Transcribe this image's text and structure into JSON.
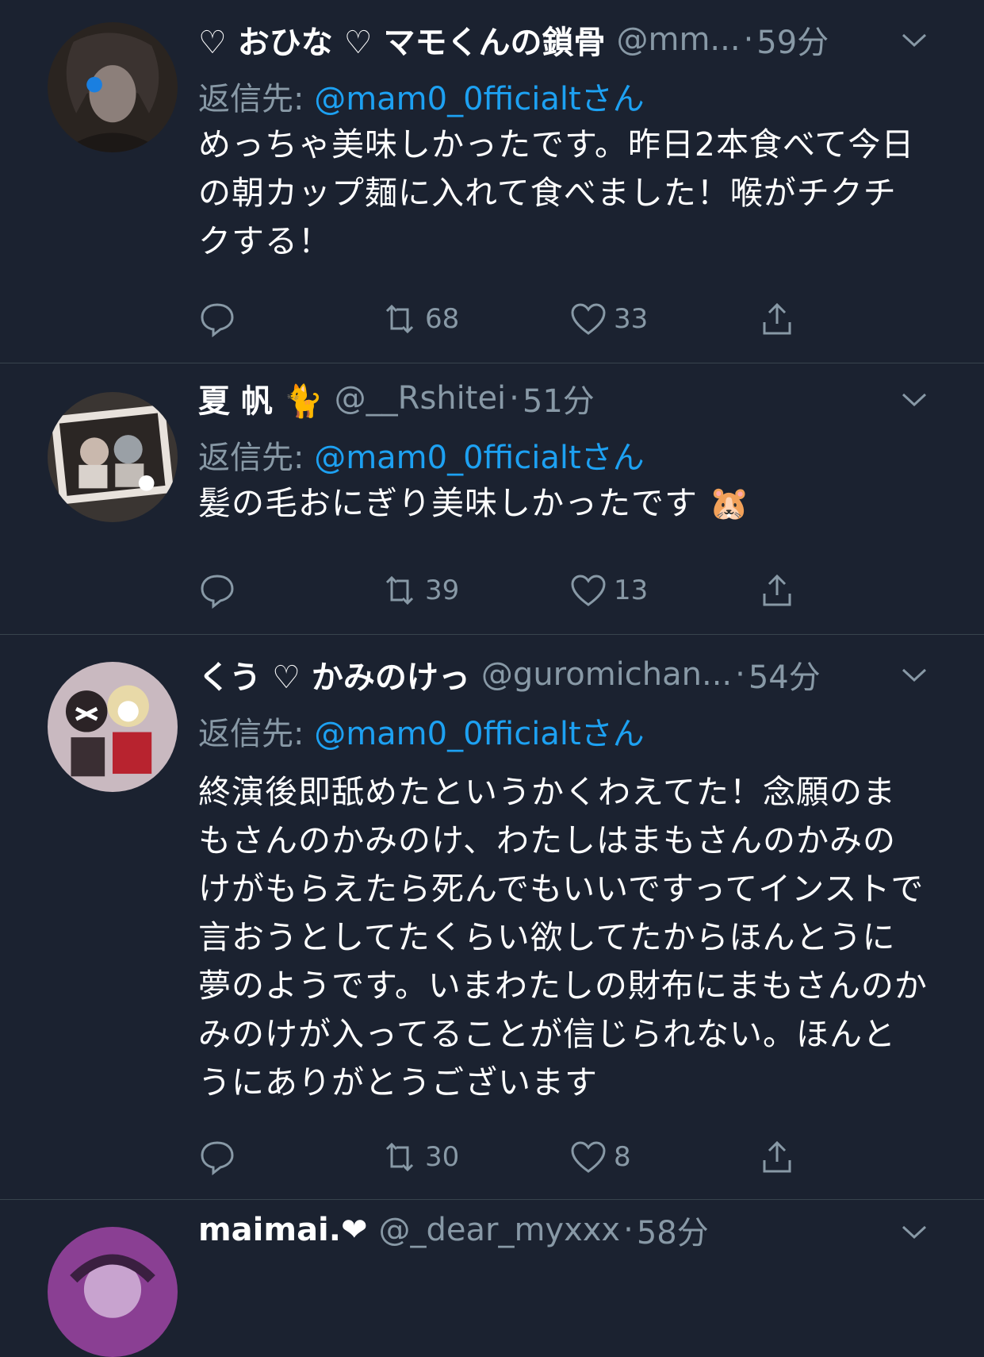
{
  "tweets": [
    {
      "name": "♡ おひな ♡ マモくんの鎖骨",
      "handle": "@mm...",
      "time": "59分",
      "reply_prefix": "返信先: ",
      "reply_mention": "@mam0_0fficialtさん",
      "text": "めっちゃ美味しかったです。昨日2本食べて今日の朝カップ麺に入れて食べました！喉がチクチクする！",
      "retweets": "68",
      "likes": "33"
    },
    {
      "name": "夏 帆 🐈",
      "handle": "@__Rshitei",
      "time": "51分",
      "reply_prefix": "返信先: ",
      "reply_mention": "@mam0_0fficialtさん",
      "text": "髪の毛おにぎり美味しかったです 🐹",
      "retweets": "39",
      "likes": "13"
    },
    {
      "name": "くう ♡ かみのけっ",
      "handle": "@guromichan...",
      "time": "54分",
      "reply_prefix": "返信先: ",
      "reply_mention": "@mam0_0fficialtさん",
      "text": "終演後即舐めたというかくわえてた！念願のまもさんのかみのけ、わたしはまもさんのかみのけがもらえたら死んでもいいですってインストで言おうとしてたくらい欲してたからほんとうに夢のようです。いまわたしの財布にまもさんのかみのけが入ってることが信じられない。ほんとうにありがとうございます",
      "retweets": "30",
      "likes": "8"
    },
    {
      "name": "maimai.❤",
      "handle": "@_dear_myxxx",
      "time": "58分"
    }
  ],
  "colors": {
    "background": "#1b2230",
    "secondary_text": "#8899a6",
    "mention": "#1da1f2",
    "divider": "#38444d"
  },
  "icons": [
    "reply-icon",
    "retweet-icon",
    "like-icon",
    "share-icon",
    "chevron-down-icon"
  ]
}
